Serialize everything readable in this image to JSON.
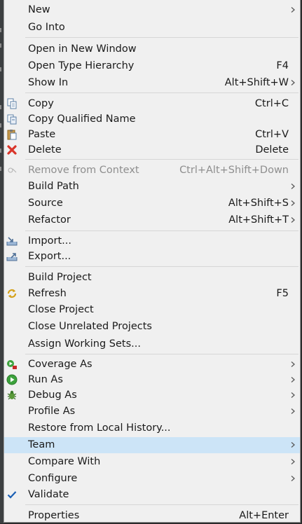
{
  "menu": {
    "items": [
      {
        "label": "New",
        "shortcut": "",
        "submenu": true,
        "icon": "",
        "disabled": false,
        "highlight": false
      },
      {
        "label": "Go Into",
        "shortcut": "",
        "submenu": false,
        "icon": "",
        "disabled": false,
        "highlight": false
      },
      {
        "label": "Open in New Window",
        "shortcut": "",
        "submenu": false,
        "icon": "",
        "disabled": false,
        "highlight": false
      },
      {
        "label": "Open Type Hierarchy",
        "shortcut": "F4",
        "submenu": false,
        "icon": "",
        "disabled": false,
        "highlight": false
      },
      {
        "label": "Show In",
        "shortcut": "Alt+Shift+W",
        "submenu": true,
        "icon": "",
        "disabled": false,
        "highlight": false
      },
      {
        "label": "Copy",
        "shortcut": "Ctrl+C",
        "submenu": false,
        "icon": "copy-icon",
        "disabled": false,
        "highlight": false
      },
      {
        "label": "Copy Qualified Name",
        "shortcut": "",
        "submenu": false,
        "icon": "copy-qualified-name-icon",
        "disabled": false,
        "highlight": false
      },
      {
        "label": "Paste",
        "shortcut": "Ctrl+V",
        "submenu": false,
        "icon": "paste-icon",
        "disabled": false,
        "highlight": false
      },
      {
        "label": "Delete",
        "shortcut": "Delete",
        "submenu": false,
        "icon": "delete-icon",
        "disabled": false,
        "highlight": false
      },
      {
        "label": "Remove from Context",
        "shortcut": "Ctrl+Alt+Shift+Down",
        "submenu": false,
        "icon": "remove-from-context-icon",
        "disabled": true,
        "highlight": false
      },
      {
        "label": "Build Path",
        "shortcut": "",
        "submenu": true,
        "icon": "",
        "disabled": false,
        "highlight": false
      },
      {
        "label": "Source",
        "shortcut": "Alt+Shift+S",
        "submenu": true,
        "icon": "",
        "disabled": false,
        "highlight": false
      },
      {
        "label": "Refactor",
        "shortcut": "Alt+Shift+T",
        "submenu": true,
        "icon": "",
        "disabled": false,
        "highlight": false
      },
      {
        "label": "Import...",
        "shortcut": "",
        "submenu": false,
        "icon": "import-icon",
        "disabled": false,
        "highlight": false
      },
      {
        "label": "Export...",
        "shortcut": "",
        "submenu": false,
        "icon": "export-icon",
        "disabled": false,
        "highlight": false
      },
      {
        "label": "Build Project",
        "shortcut": "",
        "submenu": false,
        "icon": "",
        "disabled": false,
        "highlight": false
      },
      {
        "label": "Refresh",
        "shortcut": "F5",
        "submenu": false,
        "icon": "refresh-icon",
        "disabled": false,
        "highlight": false
      },
      {
        "label": "Close Project",
        "shortcut": "",
        "submenu": false,
        "icon": "",
        "disabled": false,
        "highlight": false
      },
      {
        "label": "Close Unrelated Projects",
        "shortcut": "",
        "submenu": false,
        "icon": "",
        "disabled": false,
        "highlight": false
      },
      {
        "label": "Assign Working Sets...",
        "shortcut": "",
        "submenu": false,
        "icon": "",
        "disabled": false,
        "highlight": false
      },
      {
        "label": "Coverage As",
        "shortcut": "",
        "submenu": true,
        "icon": "coverage-icon",
        "disabled": false,
        "highlight": false
      },
      {
        "label": "Run As",
        "shortcut": "",
        "submenu": true,
        "icon": "run-icon",
        "disabled": false,
        "highlight": false
      },
      {
        "label": "Debug As",
        "shortcut": "",
        "submenu": true,
        "icon": "debug-icon",
        "disabled": false,
        "highlight": false
      },
      {
        "label": "Profile As",
        "shortcut": "",
        "submenu": true,
        "icon": "",
        "disabled": false,
        "highlight": false
      },
      {
        "label": "Restore from Local History...",
        "shortcut": "",
        "submenu": false,
        "icon": "",
        "disabled": false,
        "highlight": false
      },
      {
        "label": "Team",
        "shortcut": "",
        "submenu": true,
        "icon": "",
        "disabled": false,
        "highlight": true
      },
      {
        "label": "Compare With",
        "shortcut": "",
        "submenu": true,
        "icon": "",
        "disabled": false,
        "highlight": false
      },
      {
        "label": "Configure",
        "shortcut": "",
        "submenu": true,
        "icon": "",
        "disabled": false,
        "highlight": false
      },
      {
        "label": "Validate",
        "shortcut": "",
        "submenu": false,
        "icon": "validate-check-icon",
        "disabled": false,
        "highlight": false
      },
      {
        "label": "Properties",
        "shortcut": "Alt+Enter",
        "submenu": false,
        "icon": "",
        "disabled": false,
        "highlight": false
      }
    ]
  }
}
